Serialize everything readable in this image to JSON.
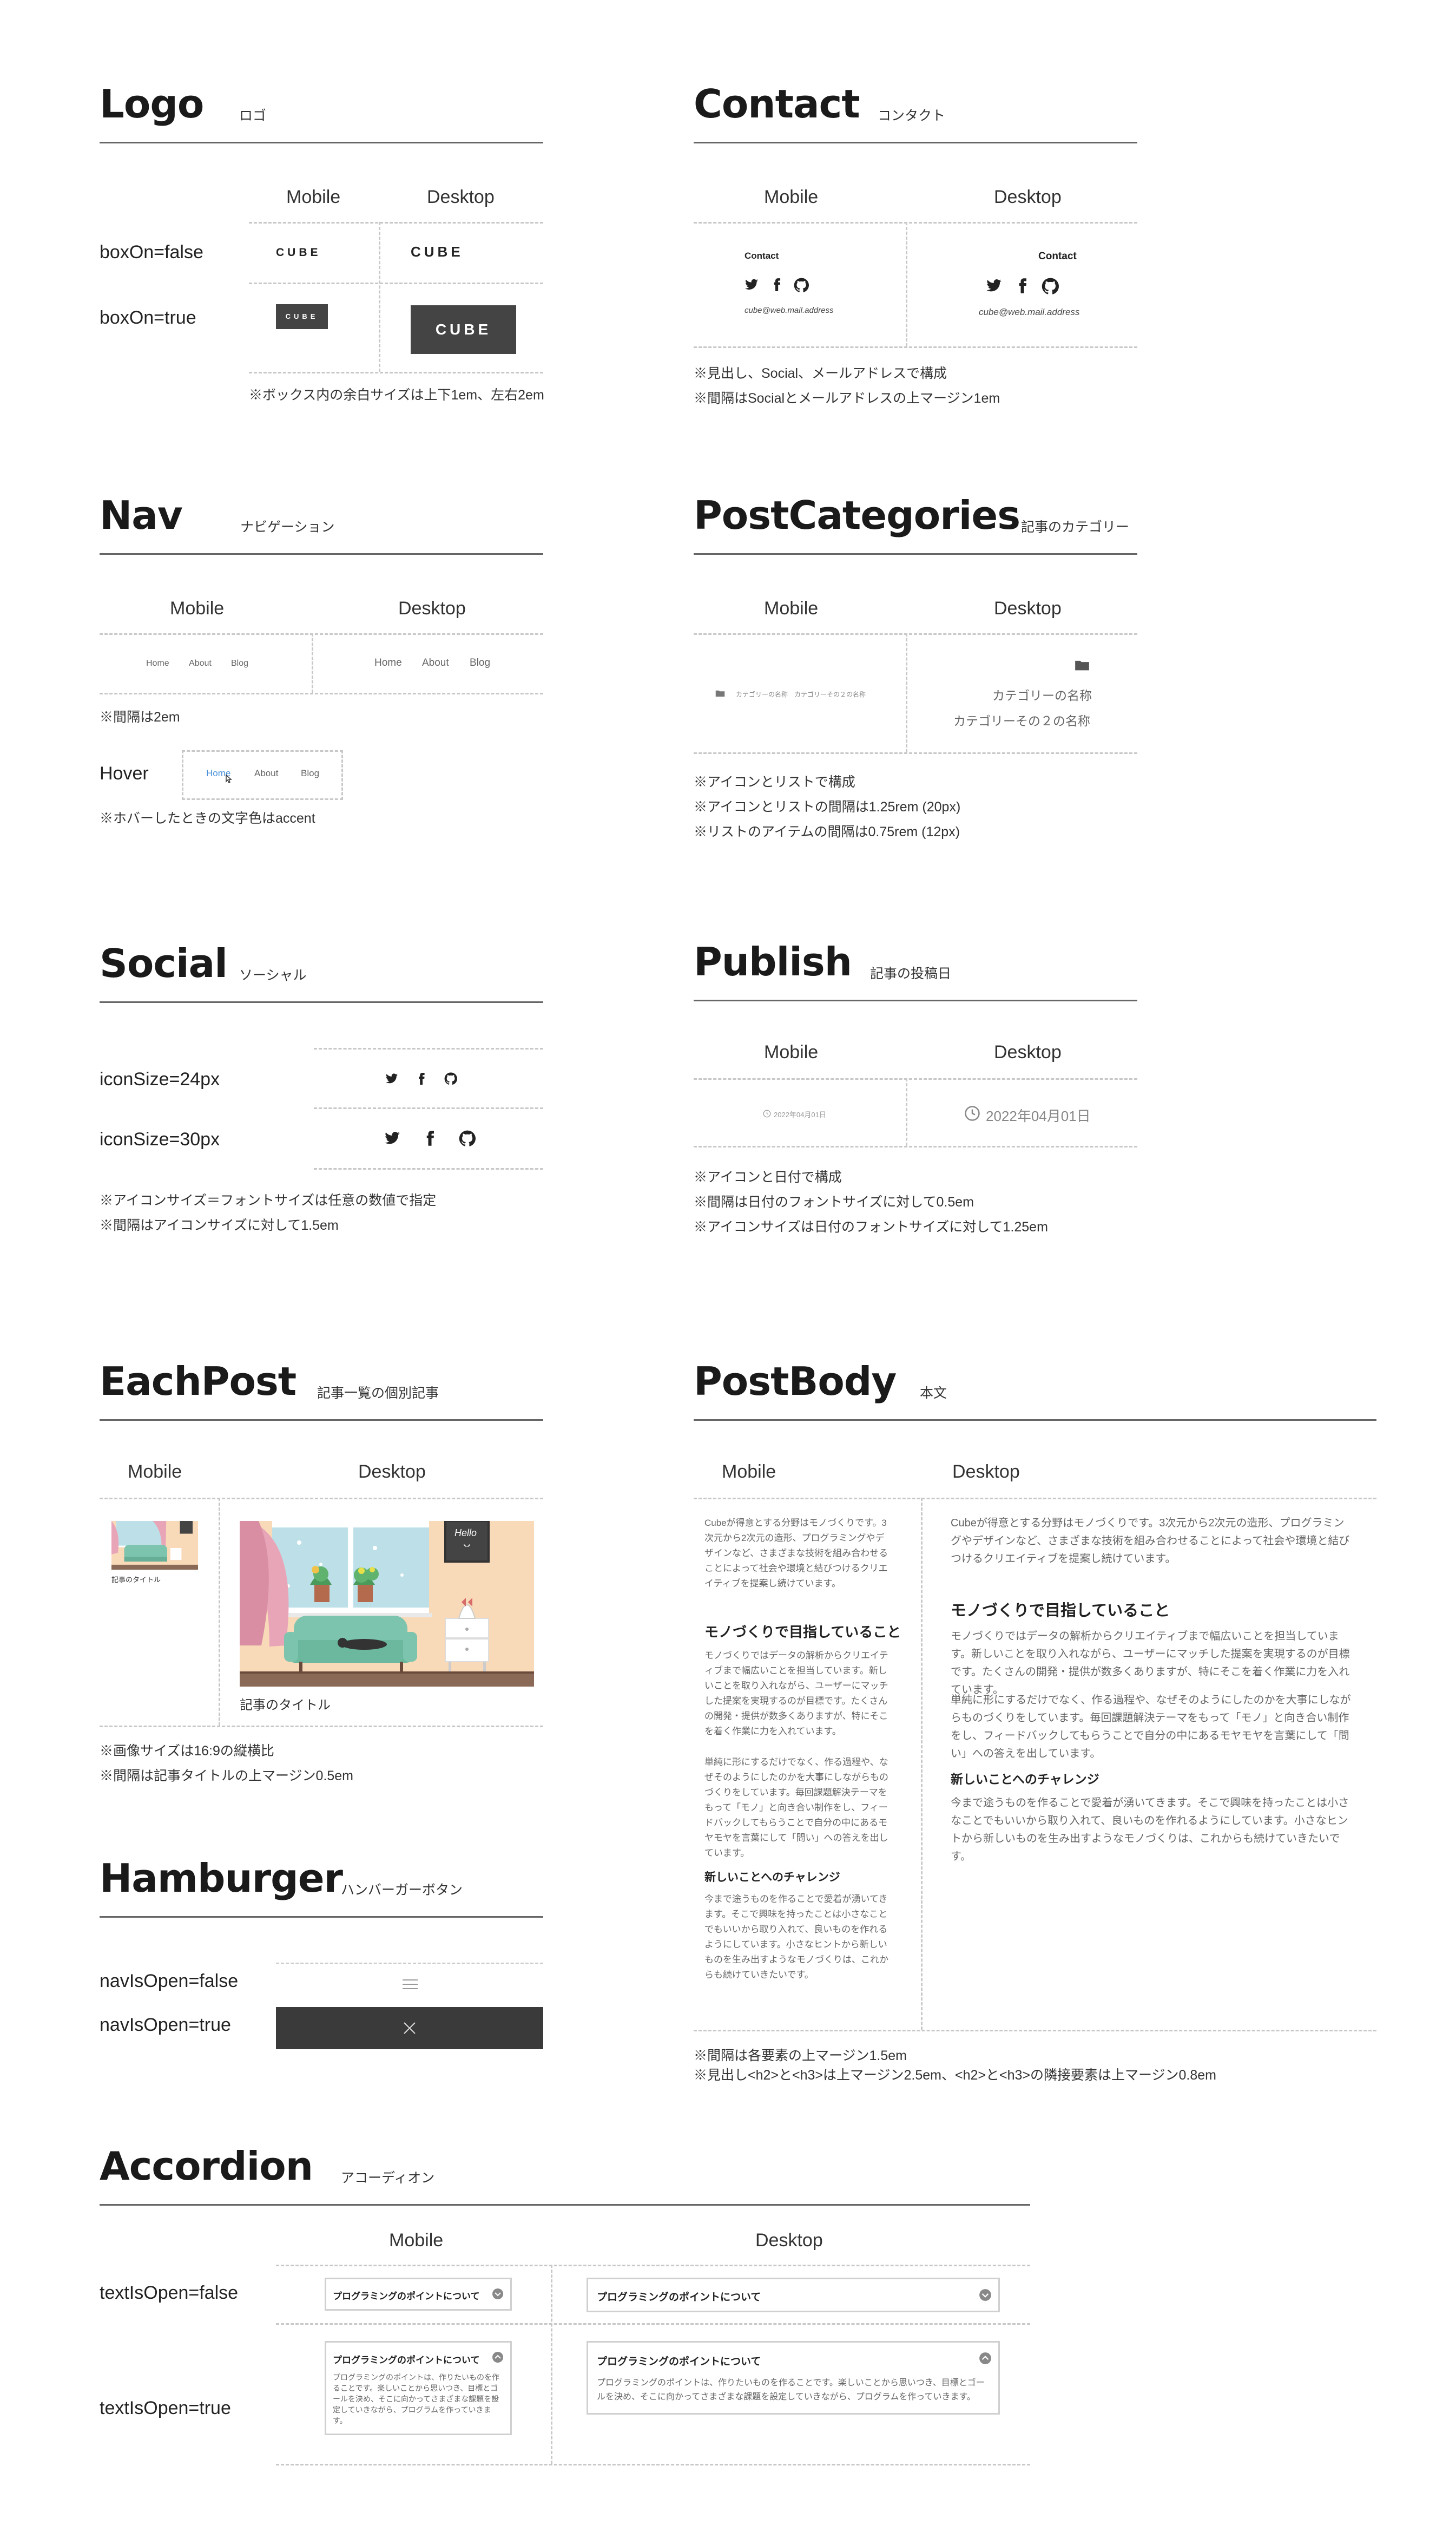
{
  "colors": {
    "accent": "#4a90d9",
    "dark_box": "#444444",
    "hamburger_open": "#3a3a3a",
    "rule": "#666666",
    "dashed": "#c8c8c8",
    "scene_wall": "#f8d9b8",
    "scene_sofa": "#7cc4ad"
  },
  "logo": {
    "title": "Logo",
    "subtitle": "ロゴ",
    "col_mobile": "Mobile",
    "col_desktop": "Desktop",
    "row_false": "boxOn=false",
    "row_true": "boxOn=true",
    "logo_text": "CUBE",
    "note": "※ボックス内の余白サイズは上下1em、左右2em"
  },
  "contact": {
    "title": "Contact",
    "subtitle": "コンタクト",
    "col_mobile": "Mobile",
    "col_desktop": "Desktop",
    "heading": "Contact",
    "email": "cube@web.mail.address",
    "icons": [
      "twitter-icon",
      "facebook-icon",
      "github-icon"
    ],
    "note1": "※見出し、Social、メールアドレスで構成",
    "note2": "※間隔はSocialとメールアドレスの上マージン1em"
  },
  "nav": {
    "title": "Nav",
    "subtitle": "ナビゲーション",
    "col_mobile": "Mobile",
    "col_desktop": "Desktop",
    "items": [
      "Home",
      "About",
      "Blog"
    ],
    "note_gap": "※間隔は2em",
    "hover_label": "Hover",
    "note_hover": "※ホバーしたときの文字色はaccent"
  },
  "post_categories": {
    "title": "PostCategories",
    "subtitle": "記事のカテゴリー",
    "col_mobile": "Mobile",
    "col_desktop": "Desktop",
    "mobile_text": "カテゴリーの名称　カテゴリーその２の名称",
    "items": [
      "カテゴリーの名称",
      "カテゴリーその２の名称"
    ],
    "note1": "※アイコンとリストで構成",
    "note2": "※アイコンとリストの間隔は1.25rem (20px)",
    "note3": "※リストのアイテムの間隔は0.75rem (12px)"
  },
  "social": {
    "title": "Social",
    "subtitle": "ソーシャル",
    "row_24": "iconSize=24px",
    "row_30": "iconSize=30px",
    "note1": "※アイコンサイズ＝フォントサイズは任意の数値で指定",
    "note2": "※間隔はアイコンサイズに対して1.5em"
  },
  "publish": {
    "title": "Publish",
    "subtitle": "記事の投稿日",
    "col_mobile": "Mobile",
    "col_desktop": "Desktop",
    "date": "2022年04月01日",
    "note1": "※アイコンと日付で構成",
    "note2": "※間隔は日付のフォントサイズに対して0.5em",
    "note3": "※アイコンサイズは日付のフォントサイズに対して1.25em"
  },
  "each_post": {
    "title": "EachPost",
    "subtitle": "記事一覧の個別記事",
    "col_mobile": "Mobile",
    "col_desktop": "Desktop",
    "post_title": "記事のタイトル",
    "frame_text": "Hello",
    "note1": "※画像サイズは16:9の縦横比",
    "note2": "※間隔は記事タイトルの上マージン0.5em"
  },
  "post_body": {
    "title": "PostBody",
    "subtitle": "本文",
    "col_mobile": "Mobile",
    "col_desktop": "Desktop",
    "p1": "Cubeが得意とする分野はモノづくりです。3次元から2次元の造形、プログラミングやデザインなど、さまざまな技術を組み合わせることによって社会や環境と結びつけるクリエイティブを提案し続けています。",
    "h2": "モノづくりで目指していること",
    "p2": "モノづくりではデータの解析からクリエイティブまで幅広いことを担当しています。新しいことを取り入れながら、ユーザーにマッチした提案を実現するのが目標です。たくさんの開発・提供が数多くありますが、特にそこを着く作業に力を入れています。",
    "p3": "単純に形にするだけでなく、作る過程や、なぜそのようにしたのかを大事にしながらものづくりをしています。毎回課題解決テーマをもって「モノ」と向き合い制作をし、フィードバックしてもらうことで自分の中にあるモヤモヤを言葉にして「問い」への答えを出しています。",
    "h3": "新しいことへのチャレンジ",
    "p4": "今まで途うものを作ることで愛着が湧いてきます。そこで興味を持ったことは小さなことでもいいから取り入れて、良いものを作れるようにしています。小さなヒントから新しいものを生み出すようなモノづくりは、これからも続けていきたいです。",
    "note1": "※間隔は各要素の上マージン1.5em",
    "note2": "※見出し<h2>と<h3>は上マージン2.5em、<h2>と<h3>の隣接要素は上マージン0.8em"
  },
  "hamburger": {
    "title": "Hamburger",
    "subtitle": "ハンバーガーボタン",
    "row_false": "navIsOpen=false",
    "row_true": "navIsOpen=true"
  },
  "accordion": {
    "title": "Accordion",
    "subtitle": "アコーディオン",
    "col_mobile": "Mobile",
    "col_desktop": "Desktop",
    "row_false": "textIsOpen=false",
    "row_true": "textIsOpen=true",
    "question": "プログラミングのポイントについて",
    "answer": "プログラミングのポイントは、作りたいものを作ることです。楽しいことから思いつき、目標とゴールを決め、そこに向かってさまざまな課題を設定していきながら、プログラムを作っていきます。"
  }
}
